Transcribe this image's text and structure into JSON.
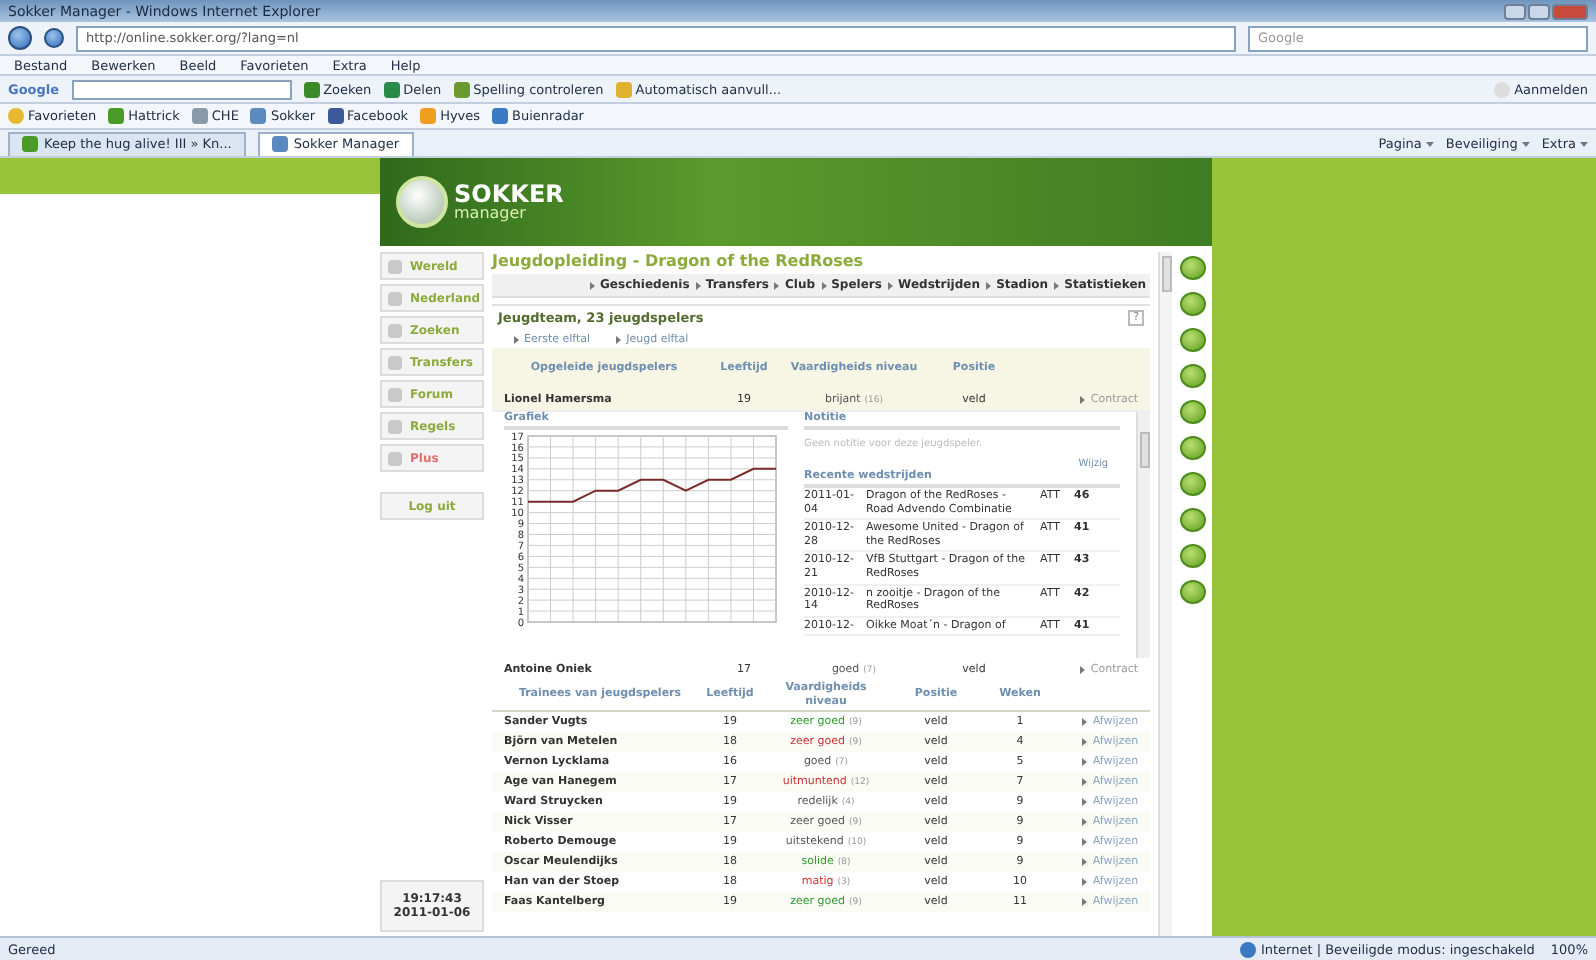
{
  "window": {
    "title": "Sokker Manager - Windows Internet Explorer"
  },
  "address_bar": {
    "url": "http://online.sokker.org/?lang=nl",
    "search_placeholder": "Google"
  },
  "menu_bar": [
    "Bestand",
    "Bewerken",
    "Beeld",
    "Favorieten",
    "Extra",
    "Help"
  ],
  "google_toolbar": {
    "brand": "Google",
    "buttons": [
      "Zoeken",
      "Delen",
      "Spelling controleren",
      "Automatisch aanvull..."
    ],
    "sign_in": "Aanmelden"
  },
  "favorites_bar": {
    "label": "Favorieten",
    "links": [
      "Hattrick",
      "CHE",
      "Sokker",
      "Facebook",
      "Hyves",
      "Buienradar"
    ]
  },
  "tabs": [
    {
      "label": "Keep the hug alive! III » Kn...",
      "selected": false
    },
    {
      "label": "Sokker Manager",
      "selected": true
    }
  ],
  "command_bar": [
    "Pagina",
    "Beveiliging",
    "Extra"
  ],
  "site": {
    "logo_top": "SOKKER",
    "logo_bottom": "manager",
    "side_menu": [
      {
        "label": "Wereld",
        "kind": "normal"
      },
      {
        "label": "Nederland",
        "kind": "normal"
      },
      {
        "label": "Zoeken",
        "kind": "normal"
      },
      {
        "label": "Transfers",
        "kind": "normal"
      },
      {
        "label": "Forum",
        "kind": "normal"
      },
      {
        "label": "Regels",
        "kind": "normal"
      },
      {
        "label": "Plus",
        "kind": "plus"
      }
    ],
    "logout": "Log uit",
    "clock": {
      "time": "19:17:43",
      "date": "2011-01-06"
    },
    "title": "Jeugdopleiding - Dragon of the RedRoses",
    "nav": [
      "Geschiedenis",
      "Transfers",
      "Club",
      "Spelers",
      "Wedstrijden",
      "Stadion",
      "Statistieken"
    ],
    "team_heading": "Jeugdteam, 23 jeugdspelers",
    "help": "?",
    "links": [
      "Eerste elftal",
      "Jeugd elftal"
    ],
    "trained": {
      "columns": [
        "Opgeleide jeugdspelers",
        "Leeftijd",
        "Vaardigheids niveau",
        "Positie"
      ],
      "rows": [
        {
          "name": "Lionel Hamersma",
          "age": "19",
          "skill": "brijant",
          "grade": "(16)",
          "color": "#555555",
          "position": "veld",
          "action": "Contract",
          "expanded": true
        },
        {
          "name": "Antoine Oniek",
          "age": "17",
          "skill": "goed",
          "grade": "(7)",
          "color": "#555555",
          "position": "veld",
          "action": "Contract",
          "expanded": false
        }
      ]
    },
    "detail": {
      "chart_title": "Grafiek",
      "chart_data": {
        "type": "line",
        "grid": true,
        "series": [
          {
            "color": "#7a2a2a",
            "values": [
              11,
              11,
              11,
              12,
              12,
              13,
              13,
              12,
              13,
              13,
              14,
              14
            ]
          }
        ],
        "ylim": [
          0,
          17
        ],
        "yticks": [
          0,
          1,
          2,
          3,
          4,
          5,
          6,
          7,
          8,
          9,
          10,
          11,
          12,
          13,
          14,
          15,
          16,
          17
        ]
      },
      "note_title": "Notitie",
      "note_placeholder": "Geen notitie voor deze jeugdspeler.",
      "note_action": "Wijzig",
      "matches_title": "Recente wedstrijden",
      "matches": [
        {
          "date": "2011-01-04",
          "teams": "Dragon of the RedRoses - Road Advendo Combinatie",
          "position": "ATT",
          "rating": "46"
        },
        {
          "date": "2010-12-28",
          "teams": "Awesome United - Dragon of the RedRoses",
          "position": "ATT",
          "rating": "41"
        },
        {
          "date": "2010-12-21",
          "teams": "VfB Stuttgart - Dragon of the RedRoses",
          "position": "ATT",
          "rating": "43"
        },
        {
          "date": "2010-12-14",
          "teams": "n zooitje - Dragon of the RedRoses",
          "position": "ATT",
          "rating": "42"
        },
        {
          "date": "2010-12-",
          "teams": "Oikke Moat´n - Dragon of",
          "position": "ATT",
          "rating": "41"
        }
      ]
    },
    "trainees": {
      "columns": [
        "Trainees van jeugdspelers",
        "Leeftijd",
        "Vaardigheids niveau",
        "Positie",
        "Weken"
      ],
      "rows": [
        {
          "name": "Sander Vugts",
          "age": "19",
          "skill": "zeer goed",
          "grade": "(9)",
          "color": "#2e9a2e",
          "position": "veld",
          "weeks": "1",
          "action": "Afwijzen"
        },
        {
          "name": "Björn van Metelen",
          "age": "18",
          "skill": "zeer goed",
          "grade": "(9)",
          "color": "#c83232",
          "position": "veld",
          "weeks": "4",
          "action": "Afwijzen"
        },
        {
          "name": "Vernon Lycklama",
          "age": "16",
          "skill": "goed",
          "grade": "(7)",
          "color": "#555555",
          "position": "veld",
          "weeks": "5",
          "action": "Afwijzen"
        },
        {
          "name": "Age van Hanegem",
          "age": "17",
          "skill": "uitmuntend",
          "grade": "(12)",
          "color": "#c83232",
          "position": "veld",
          "weeks": "7",
          "action": "Afwijzen"
        },
        {
          "name": "Ward Struycken",
          "age": "19",
          "skill": "redelijk",
          "grade": "(4)",
          "color": "#555555",
          "position": "veld",
          "weeks": "9",
          "action": "Afwijzen"
        },
        {
          "name": "Nick Visser",
          "age": "17",
          "skill": "zeer goed",
          "grade": "(9)",
          "color": "#555555",
          "position": "veld",
          "weeks": "9",
          "action": "Afwijzen"
        },
        {
          "name": "Roberto Demouge",
          "age": "19",
          "skill": "uitstekend",
          "grade": "(10)",
          "color": "#555555",
          "position": "veld",
          "weeks": "9",
          "action": "Afwijzen"
        },
        {
          "name": "Oscar Meulendijks",
          "age": "18",
          "skill": "solide",
          "grade": "(8)",
          "color": "#2e9a2e",
          "position": "veld",
          "weeks": "9",
          "action": "Afwijzen"
        },
        {
          "name": "Han van der Stoep",
          "age": "18",
          "skill": "matig",
          "grade": "(3)",
          "color": "#c83232",
          "position": "veld",
          "weeks": "10",
          "action": "Afwijzen"
        },
        {
          "name": "Faas Kantelberg",
          "age": "19",
          "skill": "zeer goed",
          "grade": "(9)",
          "color": "#2e9a2e",
          "position": "veld",
          "weeks": "11",
          "action": "Afwijzen"
        }
      ]
    }
  },
  "status_bar": {
    "status": "Gereed",
    "zone": "Internet | Beveiligde modus: ingeschakeld",
    "zoom": "100%"
  }
}
